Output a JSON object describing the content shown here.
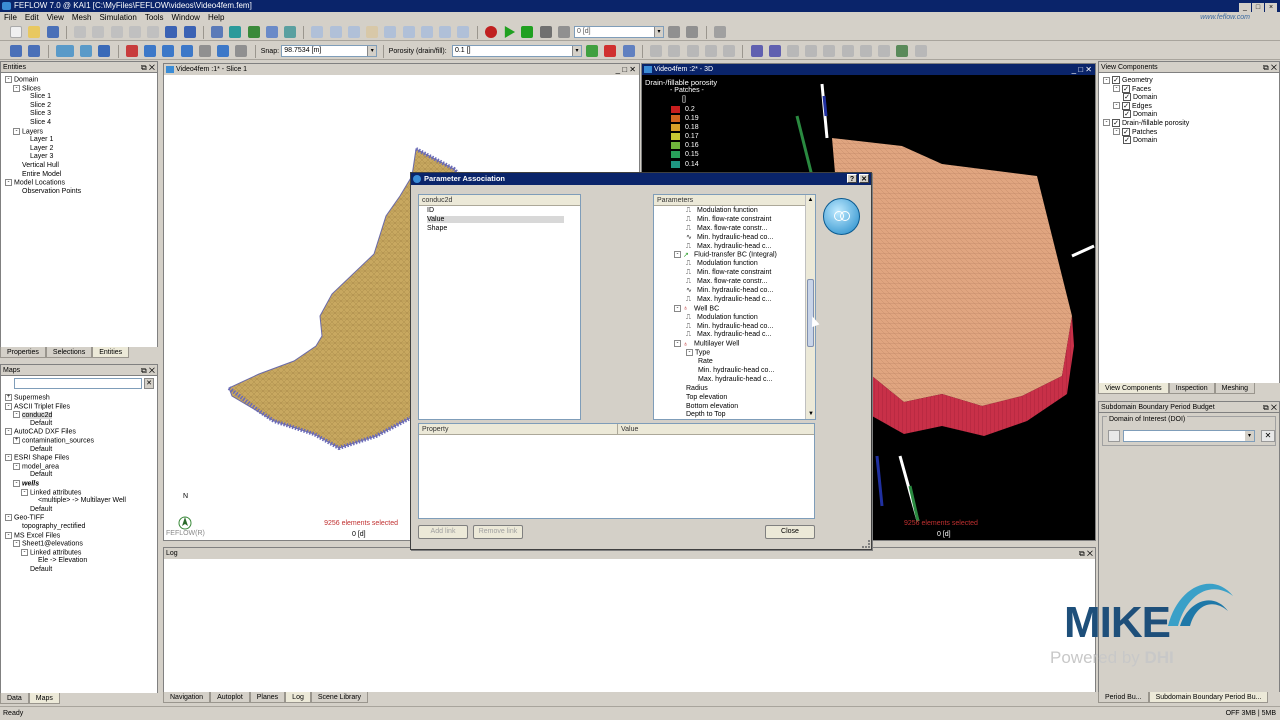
{
  "window": {
    "title": "FEFLOW 7.0 @ KAI1 [C:\\MyFiles\\FEFLOW\\videos\\Video4fem.fem]",
    "brand": "www.feflow.com"
  },
  "menu": [
    "File",
    "Edit",
    "View",
    "Mesh",
    "Simulation",
    "Tools",
    "Window",
    "Help"
  ],
  "toolbar": {
    "time_value": "0 [d]",
    "snap_label": "Snap:",
    "snap_value": "98.7534 [m]",
    "parameter_label": "Porosity (drain/fill):",
    "parameter_value": "0.1 []"
  },
  "entities": {
    "title": "Entities",
    "tree": [
      {
        "label": "Domain",
        "level": 0,
        "expander": "-"
      },
      {
        "label": "Slices",
        "level": 1,
        "expander": "-"
      },
      {
        "label": "Slice 1",
        "level": 2
      },
      {
        "label": "Slice 2",
        "level": 2
      },
      {
        "label": "Slice 3",
        "level": 2
      },
      {
        "label": "Slice 4",
        "level": 2
      },
      {
        "label": "Layers",
        "level": 1,
        "expander": "-"
      },
      {
        "label": "Layer 1",
        "level": 2
      },
      {
        "label": "Layer 2",
        "level": 2
      },
      {
        "label": "Layer 3",
        "level": 2
      },
      {
        "label": "Vertical Hull",
        "level": 1
      },
      {
        "label": "Entire Model",
        "level": 1
      },
      {
        "label": "Model Locations",
        "level": 0,
        "expander": "-"
      },
      {
        "label": "Observation Points",
        "level": 1
      }
    ],
    "tabs": [
      "Properties",
      "Selections",
      "Entities"
    ],
    "active_tab": 2
  },
  "maps": {
    "title": "Maps",
    "tree": [
      {
        "label": "Supermesh",
        "level": 0,
        "expander": "+"
      },
      {
        "label": "ASCII Triplet Files",
        "level": 0,
        "expander": "-"
      },
      {
        "label": "conduc2d",
        "level": 1,
        "expander": "-",
        "selected": true
      },
      {
        "label": "Default",
        "level": 2
      },
      {
        "label": "AutoCAD DXF Files",
        "level": 0,
        "expander": "-"
      },
      {
        "label": "contamination_sources",
        "level": 1,
        "expander": "+"
      },
      {
        "label": "Default",
        "level": 2
      },
      {
        "label": "ESRI Shape Files",
        "level": 0,
        "expander": "-"
      },
      {
        "label": "model_area",
        "level": 1,
        "expander": "-"
      },
      {
        "label": "Default",
        "level": 2
      },
      {
        "label": "wells",
        "level": 1,
        "expander": "-",
        "italic": true
      },
      {
        "label": "Linked attributes",
        "level": 2,
        "expander": "-"
      },
      {
        "label": "<multiple> -> Multilayer Well",
        "level": 3
      },
      {
        "label": "Default",
        "level": 2
      },
      {
        "label": "Geo-TIFF",
        "level": 0,
        "expander": "-"
      },
      {
        "label": "topography_rectified",
        "level": 1
      },
      {
        "label": "MS Excel Files",
        "level": 0,
        "expander": "-"
      },
      {
        "label": "Sheet1@elevations",
        "level": 1,
        "expander": "-"
      },
      {
        "label": "Linked attributes",
        "level": 2,
        "expander": "-"
      },
      {
        "label": "Ele -> Elevation",
        "level": 3
      },
      {
        "label": "Default",
        "level": 2
      }
    ],
    "tabs": [
      "Data",
      "Maps"
    ],
    "active_tab": 1
  },
  "view_slice": {
    "title": "Video4fem :1* - Slice 1",
    "selected": "9256 elements selected",
    "time": "0 [d]",
    "footer": "FEFLOW(R)",
    "north": "N"
  },
  "view_3d": {
    "title": "Video4fem :2* - 3D",
    "legend_title": "Drain-/fillable porosity",
    "legend_subtitle": "- Patches -",
    "legend_unit": "[]",
    "legend": [
      {
        "value": "0.2",
        "color": "#c81e1e"
      },
      {
        "value": "0.19",
        "color": "#d2641e"
      },
      {
        "value": "0.18",
        "color": "#d8a028"
      },
      {
        "value": "0.17",
        "color": "#c8c832"
      },
      {
        "value": "0.16",
        "color": "#6eb43c"
      },
      {
        "value": "0.15",
        "color": "#28a05a"
      },
      {
        "value": "0.14",
        "color": "#1e9682"
      }
    ],
    "selected": "9256 elements selected",
    "time": "0 [d]"
  },
  "log": {
    "title": "Log"
  },
  "bottom_tabs": [
    "Navigation",
    "Autoplot",
    "Planes",
    "Log",
    "Scene Library"
  ],
  "bottom_active_tab": 3,
  "view_components": {
    "title": "View Components",
    "tree": [
      {
        "label": "Geometry",
        "level": 0,
        "expander": "-",
        "checked": true
      },
      {
        "label": "Faces",
        "level": 1,
        "expander": "-",
        "checked": true
      },
      {
        "label": "Domain",
        "level": 2,
        "checked": true
      },
      {
        "label": "Edges",
        "level": 1,
        "expander": "-",
        "checked": true
      },
      {
        "label": "Domain",
        "level": 2,
        "checked": true
      },
      {
        "label": "Drain-/fillable porosity",
        "level": 0,
        "expander": "-",
        "checked": true
      },
      {
        "label": "Patches",
        "level": 1,
        "expander": "-",
        "checked": true
      },
      {
        "label": "Domain",
        "level": 2,
        "checked": true
      }
    ],
    "tabs": [
      "View Components",
      "Inspection",
      "Meshing"
    ],
    "active_tab": 0
  },
  "boundary_budget": {
    "title": "Subdomain Boundary Period Budget",
    "field_label": "Domain of Interest (DOI)",
    "tabs": [
      "Period Bu...",
      "Subdomain Boundary Period Bu..."
    ],
    "active_tab": 1
  },
  "dialog": {
    "title": "Parameter Association",
    "source_header": "conduc2d",
    "source_items": [
      {
        "label": "ID",
        "level": 1
      },
      {
        "label": "Value",
        "level": 1,
        "selected": true
      },
      {
        "label": "Shape",
        "level": 1
      }
    ],
    "params_header": "Parameters",
    "params_items": [
      {
        "label": "Modulation function",
        "level": 3,
        "icon": "func"
      },
      {
        "label": "Min. flow-rate constraint",
        "level": 3,
        "icon": "func"
      },
      {
        "label": "Max. flow-rate constr...",
        "level": 3,
        "icon": "func"
      },
      {
        "label": "Min. hydraulic-head co...",
        "level": 3,
        "icon": "wave"
      },
      {
        "label": "Max. hydraulic-head c...",
        "level": 3,
        "icon": "func"
      },
      {
        "label": "Fluid-transfer BC (Integral)",
        "level": 2,
        "icon": "bc",
        "expander": "-"
      },
      {
        "label": "Modulation function",
        "level": 3,
        "icon": "func"
      },
      {
        "label": "Min. flow-rate constraint",
        "level": 3,
        "icon": "func"
      },
      {
        "label": "Max. flow-rate constr...",
        "level": 3,
        "icon": "func"
      },
      {
        "label": "Min. hydraulic-head co...",
        "level": 3,
        "icon": "wave"
      },
      {
        "label": "Max. hydraulic-head c...",
        "level": 3,
        "icon": "func"
      },
      {
        "label": "Well BC",
        "level": 2,
        "icon": "well",
        "expander": "-"
      },
      {
        "label": "Modulation function",
        "level": 3,
        "icon": "func"
      },
      {
        "label": "Min. hydraulic-head co...",
        "level": 3,
        "icon": "func"
      },
      {
        "label": "Max. hydraulic-head c...",
        "level": 3,
        "icon": "func"
      },
      {
        "label": "Multilayer Well",
        "level": 2,
        "icon": "well",
        "expander": "-"
      },
      {
        "label": "Type",
        "level": 3,
        "expander": "-"
      },
      {
        "label": "Rate",
        "level": 4
      },
      {
        "label": "Min. hydraulic-head co...",
        "level": 4
      },
      {
        "label": "Max. hydraulic-head c...",
        "level": 4
      },
      {
        "label": "Radius",
        "level": 3
      },
      {
        "label": "Top elevation",
        "level": 3
      },
      {
        "label": "Bottom elevation",
        "level": 3
      },
      {
        "label": "Depth to Top",
        "level": 3
      }
    ],
    "col_property": "Property",
    "col_value": "Value",
    "add_link": "Add link",
    "remove_link": "Remove link",
    "close": "Close"
  },
  "status": {
    "text": "Ready",
    "right": "OFF 3MB | 5MB"
  },
  "watermark": {
    "main": "MIKE",
    "sub_prefix": "Powered by ",
    "sub_brand": "DHI"
  }
}
